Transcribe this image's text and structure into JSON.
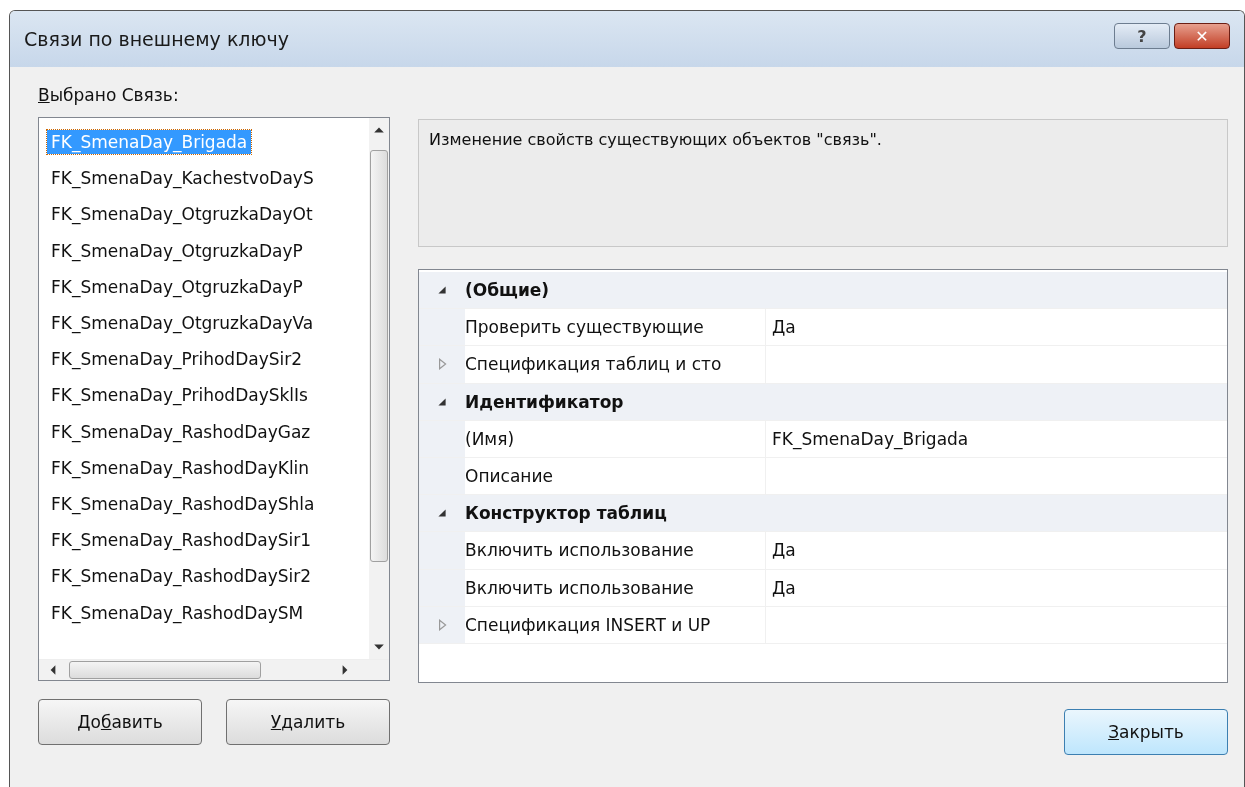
{
  "window": {
    "title": "Связи по внешнему ключу",
    "help_button": "?",
    "close_button": "✕"
  },
  "list_label": {
    "accel": "В",
    "rest": "ыбрано Связь:"
  },
  "relations": [
    {
      "label": "FK_SmenaDay_Brigada",
      "selected": true
    },
    {
      "label": "FK_SmenaDay_KachestvoDayS",
      "selected": false
    },
    {
      "label": "FK_SmenaDay_OtgruzkaDayOt",
      "selected": false
    },
    {
      "label": "FK_SmenaDay_OtgruzkaDayP",
      "selected": false
    },
    {
      "label": "FK_SmenaDay_OtgruzkaDayP",
      "selected": false
    },
    {
      "label": "FK_SmenaDay_OtgruzkaDayVa",
      "selected": false
    },
    {
      "label": "FK_SmenaDay_PrihodDaySir2",
      "selected": false
    },
    {
      "label": "FK_SmenaDay_PrihodDaySklIs",
      "selected": false
    },
    {
      "label": "FK_SmenaDay_RashodDayGaz",
      "selected": false
    },
    {
      "label": "FK_SmenaDay_RashodDayKlin",
      "selected": false
    },
    {
      "label": "FK_SmenaDay_RashodDayShla",
      "selected": false
    },
    {
      "label": "FK_SmenaDay_RashodDaySir1",
      "selected": false
    },
    {
      "label": "FK_SmenaDay_RashodDaySir2",
      "selected": false
    },
    {
      "label": "FK_SmenaDay_RashodDaySM",
      "selected": false
    }
  ],
  "description": "Изменение свойств существующих объектов \"связь\".",
  "properties": [
    {
      "kind": "category",
      "label": "(Общие)",
      "expanded": true
    },
    {
      "kind": "property",
      "label": "Проверить существующие",
      "value": "Да"
    },
    {
      "kind": "property",
      "label": "Спецификация таблиц и сто",
      "expanded": false
    },
    {
      "kind": "category",
      "label": "Идентификатор",
      "expanded": true
    },
    {
      "kind": "property",
      "label": "(Имя)",
      "value": "FK_SmenaDay_Brigada"
    },
    {
      "kind": "property",
      "label": "Описание"
    },
    {
      "kind": "category",
      "label": "Конструктор таблиц",
      "expanded": true
    },
    {
      "kind": "property",
      "label": "Включить использование",
      "value": "Да"
    },
    {
      "kind": "property",
      "label": "Включить использование",
      "value": "Да"
    },
    {
      "kind": "property",
      "label": "Спецификация INSERT и UP",
      "expanded": false
    }
  ],
  "buttons": [
    {
      "before": "До",
      "accel": "б",
      "after": "авить"
    },
    {
      "accel": "У",
      "after": "далить"
    }
  ],
  "close": {
    "accel": "З",
    "after": "акрыть"
  }
}
